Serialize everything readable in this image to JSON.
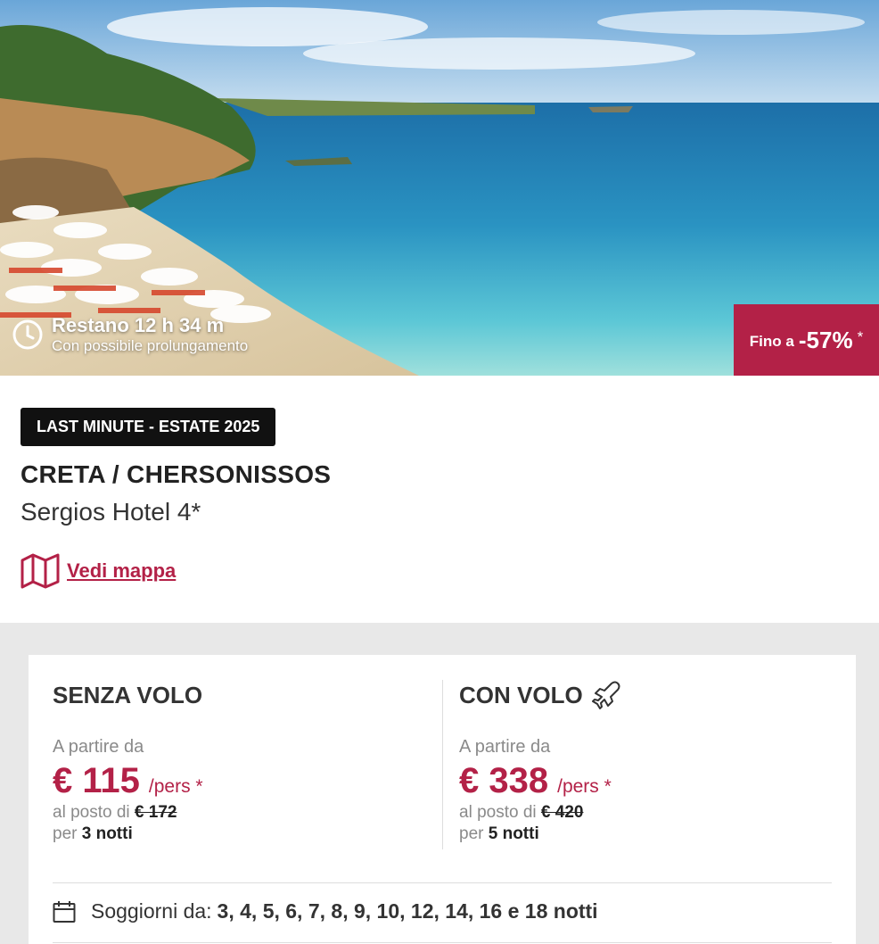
{
  "hero": {
    "timer_title": "Restano 12 h 34 m",
    "timer_subtitle": "Con possibile prolungamento",
    "discount_prefix": "Fino a",
    "discount_value": "-57%",
    "discount_asterisk": "*"
  },
  "offer": {
    "badge": "LAST MINUTE - ESTATE 2025",
    "location": "CRETA / CHERSONISSOS",
    "hotel": "Sergios Hotel 4*",
    "map_link": "Vedi mappa"
  },
  "pricing": {
    "without_flight": {
      "title": "SENZA VOLO",
      "from_label": "A partire da",
      "price": "€ 115",
      "per": "/pers *",
      "instead_label": "al posto di",
      "old_price": "€ 172",
      "nights_label": "per",
      "nights": "3 notti"
    },
    "with_flight": {
      "title": "CON VOLO",
      "icon": "plane-icon",
      "from_label": "A partire da",
      "price": "€ 338",
      "per": "/pers *",
      "instead_label": "al posto di",
      "old_price": "€ 420",
      "nights_label": "per",
      "nights": "5 notti"
    },
    "stays_label": "Soggiorni da:",
    "stays_values": "3, 4, 5, 6, 7, 8, 9, 10, 12, 14, 16 e 18 notti"
  },
  "colors": {
    "accent": "#b32147",
    "badge_bg": "#111111",
    "section_bg": "#e8e8e8"
  }
}
